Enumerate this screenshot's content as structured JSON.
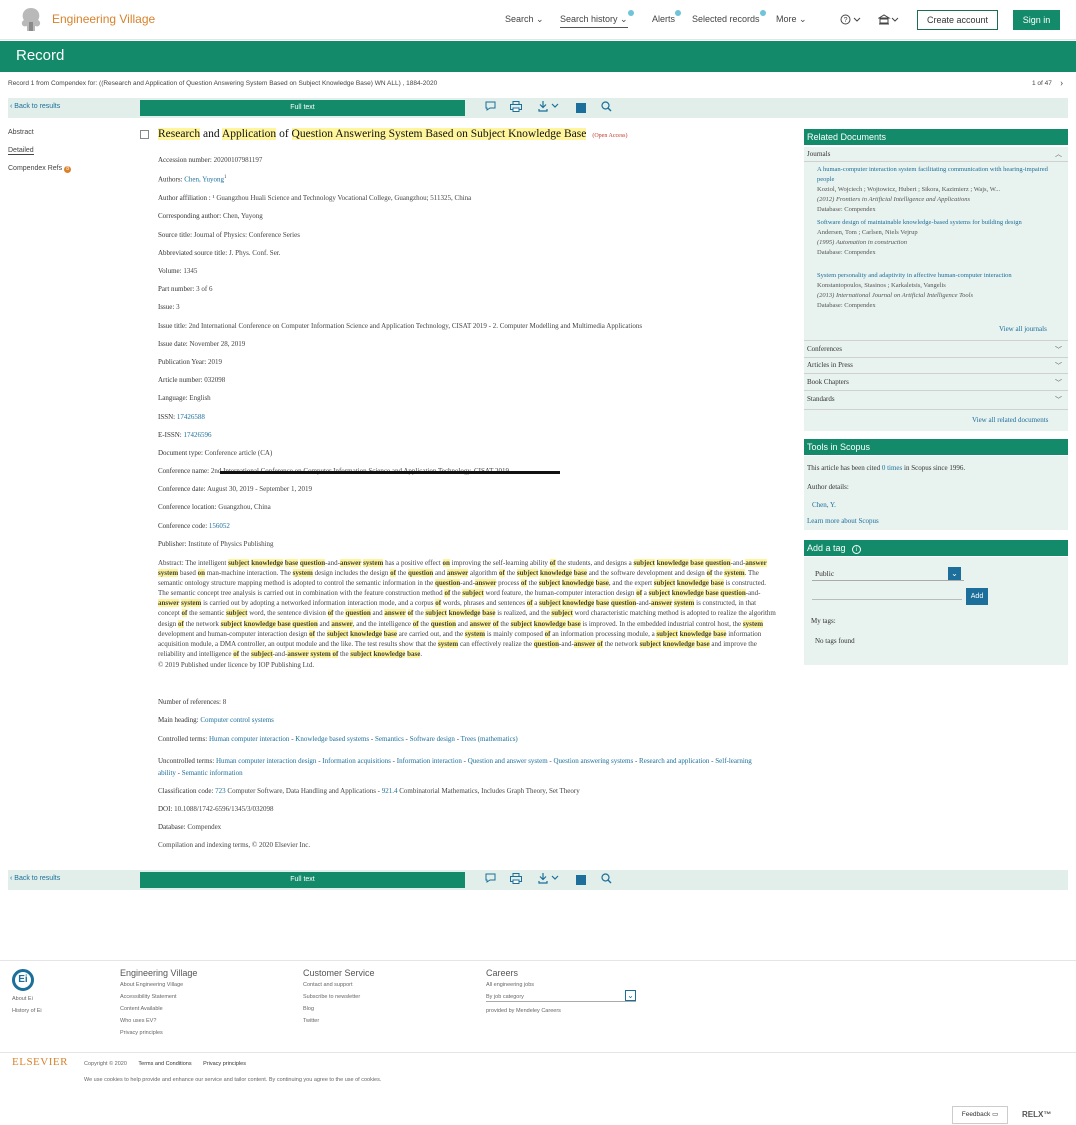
{
  "header": {
    "brand": "Engineering Village",
    "nav": {
      "search": "Search",
      "search_history": "Search history",
      "alerts": "Alerts",
      "selected_records": "Selected records",
      "more": "More"
    },
    "create_account": "Create account",
    "sign_in": "Sign in"
  },
  "page_title": "Record",
  "record_info": "Record 1 from Compendex for: ((Research and Application of Question Answering System Based on Subject Knowledge Base) WN ALL) , 1884-2020",
  "record_count": "1 of 47",
  "toolbar": {
    "back": "Back to results",
    "full_text": "Full text"
  },
  "left_nav": [
    "Abstract",
    "Detailed",
    "Compendex Refs"
  ],
  "record": {
    "title_parts": [
      "Research",
      " and ",
      "Application",
      " of ",
      "Question Answering System Based on Subject Knowledge Base"
    ],
    "open_access": "(Open Access)",
    "fields": [
      {
        "label": "Accession number: ",
        "value": "20200107981197"
      },
      {
        "label": "Authors: ",
        "value": "Chen, Yuyong",
        "link": true,
        "sup": "1"
      },
      {
        "label": "Author affiliation : ",
        "value": "¹ Guangzhou Huali Science and Technology Vocational College, Guangzhou; 511325, China"
      },
      {
        "label": "Corresponding author: ",
        "value": "Chen, Yuyong"
      },
      {
        "label": "Source title: ",
        "value": "Journal of Physics: Conference Series"
      },
      {
        "label": "Abbreviated source title: ",
        "value": "J. Phys. Conf. Ser."
      },
      {
        "label": "Volume: ",
        "value": "1345"
      },
      {
        "label": "Part number: ",
        "value": "3 of 6"
      },
      {
        "label": "Issue: ",
        "value": "3"
      },
      {
        "label": "Issue title: ",
        "value": "2nd International Conference on Computer Information Science and Application Technology, CISAT 2019 - 2. Computer Modelling and Multimedia Applications"
      },
      {
        "label": "Issue date: ",
        "value": "November 28, 2019"
      },
      {
        "label": "Publication Year: ",
        "value": "2019"
      },
      {
        "label": "Article number: ",
        "value": "032098"
      },
      {
        "label": "Language: ",
        "value": "English"
      },
      {
        "label": "ISSN: ",
        "value": "17426588",
        "link": true
      },
      {
        "label": "E-ISSN: ",
        "value": "17426596",
        "link": true
      },
      {
        "label": "Document type: ",
        "value": "Conference article (CA)"
      },
      {
        "label": "Conference name: ",
        "value": "2nd International Conference on Computer Information Science and Application Technology, CISAT 2019"
      },
      {
        "label": "Conference date: ",
        "value": "August 30, 2019 - September 1, 2019"
      },
      {
        "label": "Conference location: ",
        "value": "Guangzhou, China"
      },
      {
        "label": "Conference code: ",
        "value": "156052",
        "link": true
      },
      {
        "label": "Publisher: ",
        "value": "Institute of Physics Publishing"
      }
    ],
    "abstract_label": "Abstract: ",
    "abstract": "The intelligent subject knowledge base question-and-answer system has a positive effect on improving the self-learning ability of the students, and designs a subject knowledge base question-and-answer system based on man-machine interaction. The system design includes the design of the question and answer algorithm of the subject knowledge base and the software development and design of the system. The semantic ontology structure mapping method is adopted to control the semantic information in the question-and-answer process of the subject knowledge base, and the expert subject knowledge base is constructed. The semantic concept tree analysis is carried out in combination with the feature construction method of the subject word feature, the human-computer interaction design of a subject knowledge base question-and-answer system is carried out by adopting a networked information interaction mode, and a corpus of words, phrases and sentences of a subject knowledge base question-and-answer system is constructed, in that concept of the semantic subject word, the sentence division of the question and answer of the subject knowledge base is realized, and the subject word characteristic matching method is adopted to realize the algorithm design of the network subject knowledge base question and answer, and the intelligence of the question and answer of the subject knowledge base is improved. In the embedded industrial control host, the system development and human-computer interaction design of the subject knowledge base are carried out, and the system is mainly composed of an information processing module, a subject knowledge base information acquisition module, a DMA controller, an output module and the like. The test results show that the system can effectively realize the question-and-answer of the network subject knowledge base and improve the reliability and intelligence of the subject-and-answer system of the subject knowledge base.",
    "copyright": "© 2019 Published under licence by IOP Publishing Ltd.",
    "num_refs": {
      "label": "Number of references: ",
      "value": "8"
    },
    "main_heading": {
      "label": "Main heading: ",
      "value": "Computer control systems"
    },
    "controlled_label": "Controlled terms: ",
    "controlled_terms": [
      "Human computer interaction",
      "Knowledge based systems",
      "Semantics",
      "Software design",
      "Trees (mathematics)"
    ],
    "uncontrolled_label": "Uncontrolled terms: ",
    "uncontrolled_terms": [
      "Human computer interaction design",
      "Information acquisitions",
      "Information interaction",
      "Question and answer system",
      "Question answering systems",
      "Research and application",
      "Self-learning ability",
      "Semantic information"
    ],
    "classification_label": "Classification code: ",
    "classification": [
      {
        "code": "723",
        "text": "Computer Software, Data Handling and Applications"
      },
      {
        "code": "921.4",
        "text": "Combinatorial Mathematics, Includes Graph Theory, Set Theory"
      }
    ],
    "doi": {
      "label": "DOI: ",
      "value": "10.1088/1742-6596/1345/3/032098"
    },
    "database": {
      "label": "Database: ",
      "value": "Compendex"
    },
    "compilation": "Compilation and indexing terms, © 2020 Elsevier Inc."
  },
  "related": {
    "title": "Related Documents",
    "journals_label": "Journals",
    "items": [
      {
        "title": "A human-computer interaction system facilitating communication with hearing-impaired people",
        "authors": "Koziol, Wojciech ; Wojtowicz, Hubert ; Sikora, Kazimierz ; Wajs, W...",
        "source": "(2012) Frontiers in Artificial Intelligence and Applications",
        "db": "Database: Compendex"
      },
      {
        "title": "Software design of maintainable knowledge-based systems for building design",
        "authors": "Andersen, Tom ; Carlsen, Niels Vejrup",
        "source": "(1995) Automation in construction",
        "db": "Database: Compendex"
      },
      {
        "title": "System personality and adaptivity in affective human-computer interaction",
        "authors": "Konstantopoulos, Stasinos ; Karkaletsis, Vangelis",
        "source": "(2013) International Journal on Artificial Intelligence Tools",
        "db": "Database: Compendex"
      }
    ],
    "view_journals": "View all journals",
    "sections": [
      "Conferences",
      "Articles in Press",
      "Book Chapters",
      "Standards"
    ],
    "view_all": "View all related documents"
  },
  "scopus": {
    "title": "Tools in Scopus",
    "cited_prefix": "This article has been cited ",
    "cited_count": "0 times",
    "cited_suffix": " in Scopus since 1996.",
    "author_details": "Author details:",
    "author": "Chen, Y.",
    "learn_more": "Learn more about Scopus"
  },
  "tags": {
    "title": "Add a tag",
    "visibility": "Public",
    "add": "Add",
    "my_tags": "My tags:",
    "none": "No tags found"
  },
  "footer": {
    "about_ei": "About Ei",
    "history_ei": "History of Ei",
    "col1": {
      "title": "Engineering Village",
      "links": [
        "About Engineering Village",
        "Accessibility Statement",
        "Content Available",
        "Who uses EV?",
        "Privacy principles"
      ]
    },
    "col2": {
      "title": "Customer Service",
      "links": [
        "Contact and support",
        "Subscribe to newsletter",
        "Blog",
        "Twitter"
      ]
    },
    "col3": {
      "title": "Careers",
      "links": [
        "All engineering jobs"
      ],
      "select": "By job category",
      "provided": "provided by Mendeley Careers"
    },
    "elsevier": "ELSEVIER",
    "copyright": "Copyright © 2020",
    "terms": "Terms and Conditions",
    "privacy": "Privacy principles",
    "cookies": "We use cookies to help provide and enhance our service and tailor content. By continuing you agree to the use of cookies.",
    "feedback": "Feedback",
    "relx": "RELX™"
  },
  "colors": {
    "brand_green": "#138a6a",
    "brand_orange": "#d9822b",
    "link_blue": "#1b6f9a",
    "highlight": "#fff59d"
  }
}
